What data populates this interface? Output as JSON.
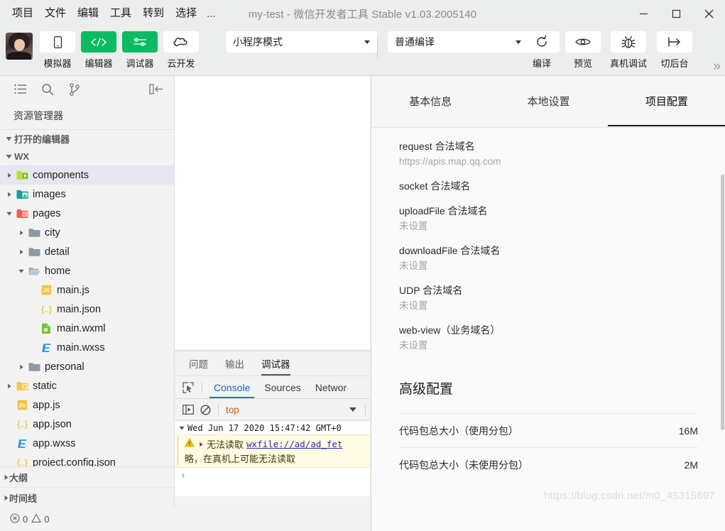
{
  "window": {
    "title": "my-test - 微信开发者工具 Stable v1.03.2005140",
    "minimize": "minimize-button",
    "maximize": "maximize-button",
    "close": "close-button"
  },
  "menubar": {
    "items": [
      {
        "label": "项目"
      },
      {
        "label": "文件"
      },
      {
        "label": "编辑"
      },
      {
        "label": "工具"
      },
      {
        "label": "转到"
      },
      {
        "label": "选择"
      }
    ],
    "more": "..."
  },
  "toolbar": {
    "avatar_name": "user-avatar",
    "buttons": [
      {
        "label": "模拟器",
        "icon": "phone-icon",
        "active": false
      },
      {
        "label": "编辑器",
        "icon": "code-icon",
        "active": true
      },
      {
        "label": "调试器",
        "icon": "sliders-icon",
        "active": true
      },
      {
        "label": "云开发",
        "icon": "cloud-icon",
        "active": false
      }
    ],
    "mode_select": "小程序模式",
    "compile_select": "普通编译",
    "actions": [
      {
        "label": "编译",
        "icon": "refresh-icon"
      },
      {
        "label": "预览",
        "icon": "eye-icon"
      },
      {
        "label": "真机调试",
        "icon": "bug-icon"
      },
      {
        "label": "切后台",
        "icon": "background-icon"
      }
    ],
    "overflow": "»"
  },
  "sidebar": {
    "icons": [
      {
        "name": "explorer-icon"
      },
      {
        "name": "search-icon"
      },
      {
        "name": "source-control-icon"
      }
    ],
    "collapse_icon": "collapse-sidebar-icon",
    "title": "资源管理器",
    "open_editors_label": "打开的编辑器",
    "root_label": "WX",
    "tree": [
      {
        "label": "components",
        "type": "folder-green",
        "depth": 1,
        "expanded": false,
        "selected": true
      },
      {
        "label": "images",
        "type": "folder-teal",
        "depth": 1,
        "expanded": false,
        "selected": false
      },
      {
        "label": "pages",
        "type": "folder-red",
        "depth": 1,
        "expanded": true,
        "selected": false
      },
      {
        "label": "city",
        "type": "folder-plain",
        "depth": 2,
        "expanded": false,
        "selected": false
      },
      {
        "label": "detail",
        "type": "folder-plain",
        "depth": 2,
        "expanded": false,
        "selected": false
      },
      {
        "label": "home",
        "type": "folder-open",
        "depth": 2,
        "expanded": true,
        "selected": false
      },
      {
        "label": "main.js",
        "type": "js",
        "depth": 3,
        "expanded": null,
        "selected": false
      },
      {
        "label": "main.json",
        "type": "json",
        "depth": 3,
        "expanded": null,
        "selected": false
      },
      {
        "label": "main.wxml",
        "type": "wxml",
        "depth": 3,
        "expanded": null,
        "selected": false
      },
      {
        "label": "main.wxss",
        "type": "wxss",
        "depth": 3,
        "expanded": null,
        "selected": false
      },
      {
        "label": "personal",
        "type": "folder-plain",
        "depth": 2,
        "expanded": false,
        "selected": false
      },
      {
        "label": "static",
        "type": "folder-yellow",
        "depth": 1,
        "expanded": false,
        "selected": false
      },
      {
        "label": "app.js",
        "type": "js",
        "depth": 1,
        "expanded": null,
        "selected": false
      },
      {
        "label": "app.json",
        "type": "json",
        "depth": 1,
        "expanded": null,
        "selected": false
      },
      {
        "label": "app.wxss",
        "type": "wxss",
        "depth": 1,
        "expanded": null,
        "selected": false
      },
      {
        "label": "project.config.json",
        "type": "json",
        "depth": 1,
        "expanded": null,
        "selected": false
      }
    ],
    "outline_label": "大纲",
    "timeline_label": "时间线",
    "status": {
      "error_icon": "error-circle-icon",
      "error_count": "0",
      "warning_icon": "warning-triangle-icon",
      "warning_count": "0"
    }
  },
  "console": {
    "panel_tabs": [
      {
        "label": "问题",
        "active": false
      },
      {
        "label": "输出",
        "active": false
      },
      {
        "label": "调试器",
        "active": true
      }
    ],
    "inspect_icon": "inspect-element-icon",
    "devtool_tabs": [
      {
        "label": "Console",
        "active": true
      },
      {
        "label": "Sources",
        "active": false
      },
      {
        "label": "Networ",
        "active": false
      }
    ],
    "sidebar_toggle_icon": "console-sidebar-icon",
    "clear_icon": "clear-console-icon",
    "context": "top",
    "log_group": "Wed Jun 17 2020 15:47:42 GMT+0",
    "warning_icon": "warning-triangle-icon",
    "warning_text": "无法读取",
    "warning_link": "wxfile://ad/ad_fet",
    "warning_line2": "略，在真机上可能无法读取",
    "prompt": "›"
  },
  "right_panel": {
    "tabs": [
      {
        "label": "基本信息",
        "active": false
      },
      {
        "label": "本地设置",
        "active": false
      },
      {
        "label": "项目配置",
        "active": true
      }
    ],
    "config_items": [
      {
        "label": "request 合法域名",
        "value": "https://apis.map.qq.com"
      },
      {
        "label": "socket 合法域名",
        "value": ""
      },
      {
        "label": "uploadFile 合法域名",
        "value": "未设置"
      },
      {
        "label": "downloadFile 合法域名",
        "value": "未设置"
      },
      {
        "label": "UDP 合法域名",
        "value": "未设置"
      },
      {
        "label": "web-view（业务域名）",
        "value": "未设置"
      }
    ],
    "advanced_title": "高级配置",
    "advanced_rows": [
      {
        "label": "代码包总大小（使用分包）",
        "value": "16M"
      },
      {
        "label": "代码包总大小（未使用分包）",
        "value": "2M"
      }
    ]
  },
  "watermark": "https://blog.csdn.net/m0_45315697",
  "colors": {
    "accent_green": "#09bb61",
    "devtools_blue": "#1a73e8",
    "selection": "#e4e6f1",
    "chrome_bg": "#eceded"
  }
}
